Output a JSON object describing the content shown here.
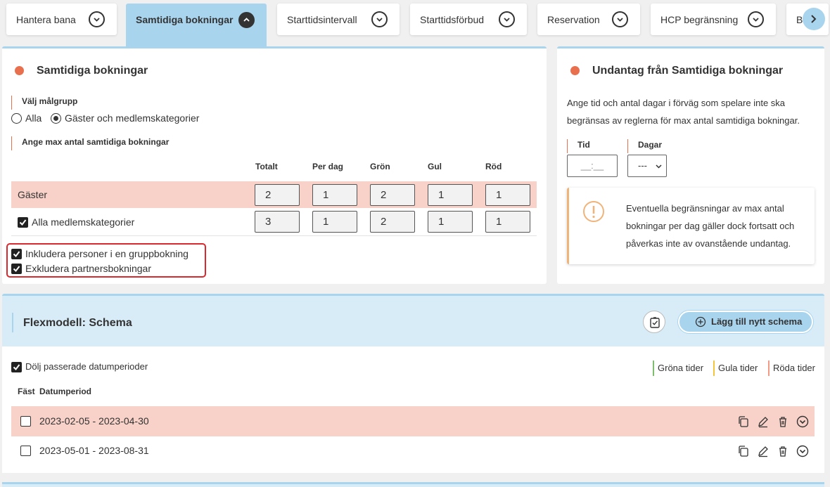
{
  "tabs": [
    {
      "label": "Hantera bana"
    },
    {
      "label": "Samtidiga bokningar"
    },
    {
      "label": "Starttidsintervall"
    },
    {
      "label": "Starttidsförbud"
    },
    {
      "label": "Reservation"
    },
    {
      "label": "HCP begränsning"
    },
    {
      "label": "B"
    }
  ],
  "main": {
    "title": "Samtidiga bokningar",
    "target_group_label": "Välj målgrupp",
    "radio_all": "Alla",
    "radio_guests": "Gäster och medlemskategorier",
    "max_label": "Ange max antal samtidiga bokningar",
    "columns": [
      "Totalt",
      "Per dag",
      "Grön",
      "Gul",
      "Röd"
    ],
    "rows": [
      {
        "label": "Gäster",
        "values": [
          "2",
          "1",
          "2",
          "1",
          "1"
        ]
      },
      {
        "label": "Alla medlemskategorier",
        "values": [
          "3",
          "1",
          "2",
          "1",
          "1"
        ]
      }
    ],
    "include_group": "Inkludera personer i en gruppbokning",
    "exclude_partner": "Exkludera partnersbokningar"
  },
  "exception": {
    "title": "Undantag från Samtidiga bokningar",
    "description": "Ange tid och antal dagar i förväg som spelare inte ska begränsas av reglerna för max antal samtidiga bokningar.",
    "tid_label": "Tid",
    "dagar_label": "Dagar",
    "tid_placeholder": "__:__",
    "dagar_value": "---",
    "info": "Eventuella begränsningar av max antal bokningar per dag gäller dock fortsatt och påverkas inte av ovanstående undantag."
  },
  "flex": {
    "title": "Flexmodell: Schema",
    "add_button": "Lägg till nytt schema",
    "hide_past": "Dölj passerade datumperioder",
    "legend": [
      "Gröna tider",
      "Gula tider",
      "Röda tider"
    ],
    "col_fast": "Fäst",
    "col_period": "Datumperiod",
    "periods": [
      "2023-02-05 - 2023-04-30",
      "2023-05-01 - 2023-08-31"
    ]
  },
  "colors": {
    "accent": "#a8d4ee",
    "dot": "#e8704f",
    "row_highlight": "#f8d2c8",
    "green": "#7dbf6e",
    "yellow": "#f2c53d",
    "red": "#f29a85"
  }
}
